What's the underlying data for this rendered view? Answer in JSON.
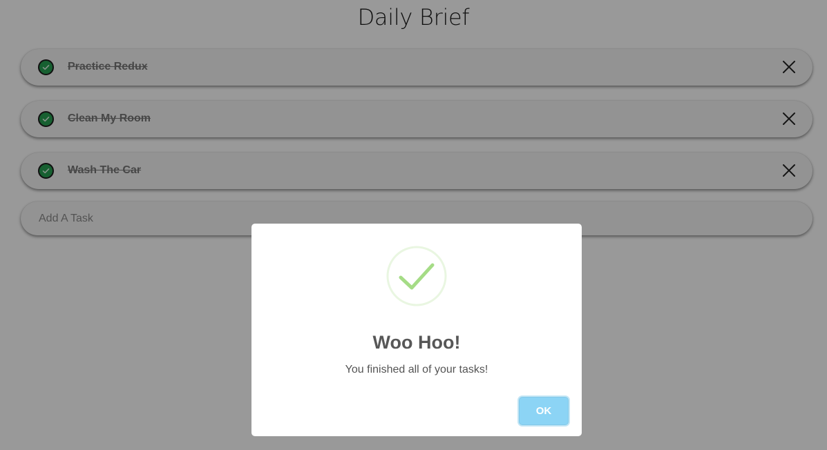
{
  "app": {
    "title": "Daily Brief"
  },
  "tasks": [
    {
      "label": "Practice Redux",
      "completed": true
    },
    {
      "label": "Clean My Room",
      "completed": true
    },
    {
      "label": "Wash The Car",
      "completed": true
    }
  ],
  "add_task": {
    "placeholder": "Add A Task",
    "value": ""
  },
  "modal": {
    "icon": "success-check-icon",
    "title": "Woo Hoo!",
    "text": "You finished all of your tasks!",
    "ok_label": "OK"
  },
  "colors": {
    "check_green": "#27a152",
    "success_icon_green": "#a5dc86",
    "ok_button_blue": "#8cd4f5",
    "overlay": "rgba(0,0,0,0.4)"
  }
}
